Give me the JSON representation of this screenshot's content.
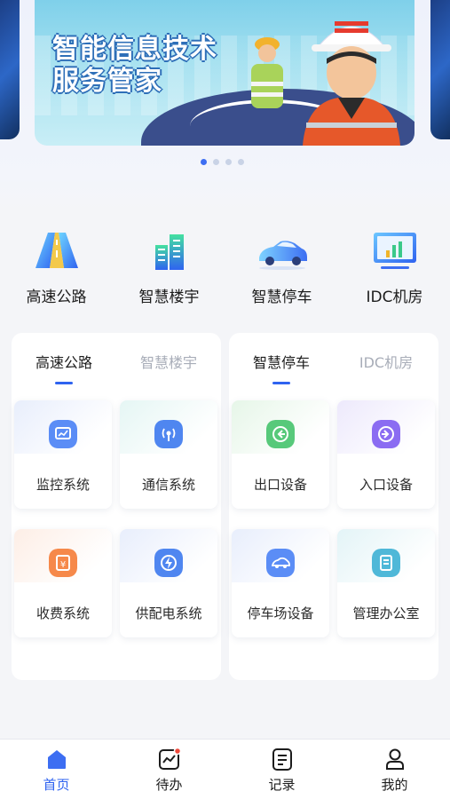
{
  "banner": {
    "title_line1": "智能信息技术",
    "title_line2": "服务管家",
    "pager_total": 4,
    "pager_active": 1
  },
  "quick_nav": [
    {
      "label": "高速公路",
      "icon": "highway-icon"
    },
    {
      "label": "智慧楼宇",
      "icon": "building-icon"
    },
    {
      "label": "智慧停车",
      "icon": "car-icon"
    },
    {
      "label": "IDC机房",
      "icon": "monitor-chart-icon"
    }
  ],
  "left_panel": {
    "tabs": [
      {
        "label": "高速公路",
        "active": true
      },
      {
        "label": "智慧楼宇",
        "active": false
      }
    ],
    "items": [
      {
        "label": "监控系统",
        "icon": "monitor-icon"
      },
      {
        "label": "通信系统",
        "icon": "signal-icon"
      },
      {
        "label": "收费系统",
        "icon": "toll-icon"
      },
      {
        "label": "供配电系统",
        "icon": "power-icon"
      }
    ]
  },
  "right_panel": {
    "tabs": [
      {
        "label": "智慧停车",
        "active": true
      },
      {
        "label": "IDC机房",
        "active": false
      }
    ],
    "items": [
      {
        "label": "出口设备",
        "icon": "exit-icon"
      },
      {
        "label": "入口设备",
        "icon": "entry-icon"
      },
      {
        "label": "停车场设备",
        "icon": "parking-car-icon"
      },
      {
        "label": "管理办公室",
        "icon": "office-icon"
      }
    ]
  },
  "tabbar": [
    {
      "label": "首页",
      "icon": "home-icon",
      "active": true
    },
    {
      "label": "待办",
      "icon": "todo-chart-icon",
      "active": false,
      "badge": true
    },
    {
      "label": "记录",
      "icon": "record-icon",
      "active": false
    },
    {
      "label": "我的",
      "icon": "user-icon",
      "active": false
    }
  ],
  "colors": {
    "accent": "#2f63f0",
    "inactive_tab": "#a8adb8"
  }
}
